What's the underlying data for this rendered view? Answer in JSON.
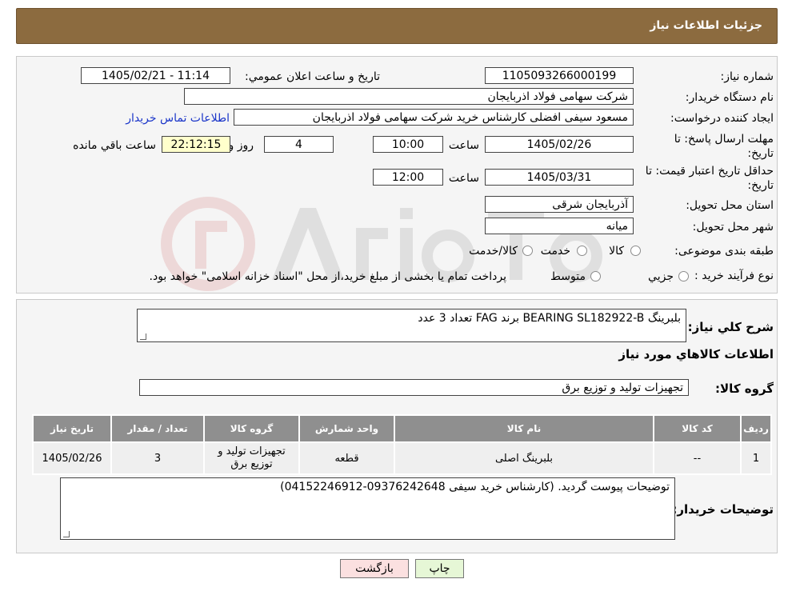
{
  "header": {
    "title": "جزئیات اطلاعات نیاز"
  },
  "form": {
    "need_number": {
      "label": "شماره نیاز:",
      "value": "1105093266000199"
    },
    "announce_datetime": {
      "label": "تاریخ و ساعت اعلان عمومي:",
      "value": "1405/02/21 - 11:14"
    },
    "buyer_org": {
      "label": "نام دستگاه خريدار:",
      "value": "شرکت سهامی فولاد اذربایجان"
    },
    "requester": {
      "label": "ايجاد کننده درخواست:",
      "value": "مسعود سیفی افضلی کارشناس خرید شرکت سهامی فولاد اذربایجان",
      "contact_link": "اطلاعات تماس خريدار"
    },
    "deadline": {
      "label_line1": "مهلت ارسال پاسخ: تا",
      "label_line2": "تاريخ:",
      "date": "1405/02/26",
      "time_label": "ساعت",
      "time": "10:00",
      "days": "4",
      "days_label": "روز و",
      "remaining": "22:12:15",
      "remaining_label": "ساعت باقي مانده"
    },
    "price_validity": {
      "label_line1": "حداقل تاريخ اعتبار قيمت: تا",
      "label_line2": "تاريخ:",
      "date": "1405/03/31",
      "time_label": "ساعت",
      "time": "12:00"
    },
    "province": {
      "label": "استان محل تحويل:",
      "value": "آذربایجان شرقی"
    },
    "city": {
      "label": "شهر محل تحويل:",
      "value": "میانه"
    },
    "category": {
      "label": "طبقه بندی موضوعی:",
      "options": [
        "کالا",
        "خدمت",
        "کالا/خدمت"
      ]
    },
    "purchase_type": {
      "label": "نوع فرآيند خريد :",
      "options": [
        "جزيي",
        "متوسط"
      ],
      "note": "پرداخت تمام يا بخشی از مبلغ خريد،از محل \"اسناد خزانه اسلامی\" خواهد بود."
    }
  },
  "summary": {
    "label": "شرح کلي نياز:",
    "value": "بلبرینگ BEARING SL182922-B برند FAG تعداد 3 عدد"
  },
  "goods_info": {
    "title": "اطلاعات کالاهاي مورد نياز",
    "group_label": "گروه کالا:",
    "group_value": "تجهیزات تولید و توزیع برق"
  },
  "table": {
    "headers": [
      "رديف",
      "کد کالا",
      "نام کالا",
      "واحد شمارش",
      "گروه کالا",
      "تعداد / مقدار",
      "تاريخ نياز"
    ],
    "rows": [
      {
        "row": "1",
        "code": "--",
        "name": "بلبرینگ اصلی",
        "unit": "قطعه",
        "group_line1": "تجهیزات تولید و",
        "group_line2": "توزیع برق",
        "qty": "3",
        "date": "1405/02/26"
      }
    ]
  },
  "buyer_notes": {
    "label": "توضيحات خريدار:",
    "value": "توضیحات پیوست گردید. (کارشناس خرید سیفی 09376242648-04152246912)"
  },
  "buttons": {
    "print": "چاپ",
    "back": "بازگشت"
  },
  "colors": {
    "header_bg": "#8c6b3f",
    "table_header": "#8f8f8f",
    "print_btn": "#e6f7d6",
    "back_btn": "#fbe0e0"
  }
}
